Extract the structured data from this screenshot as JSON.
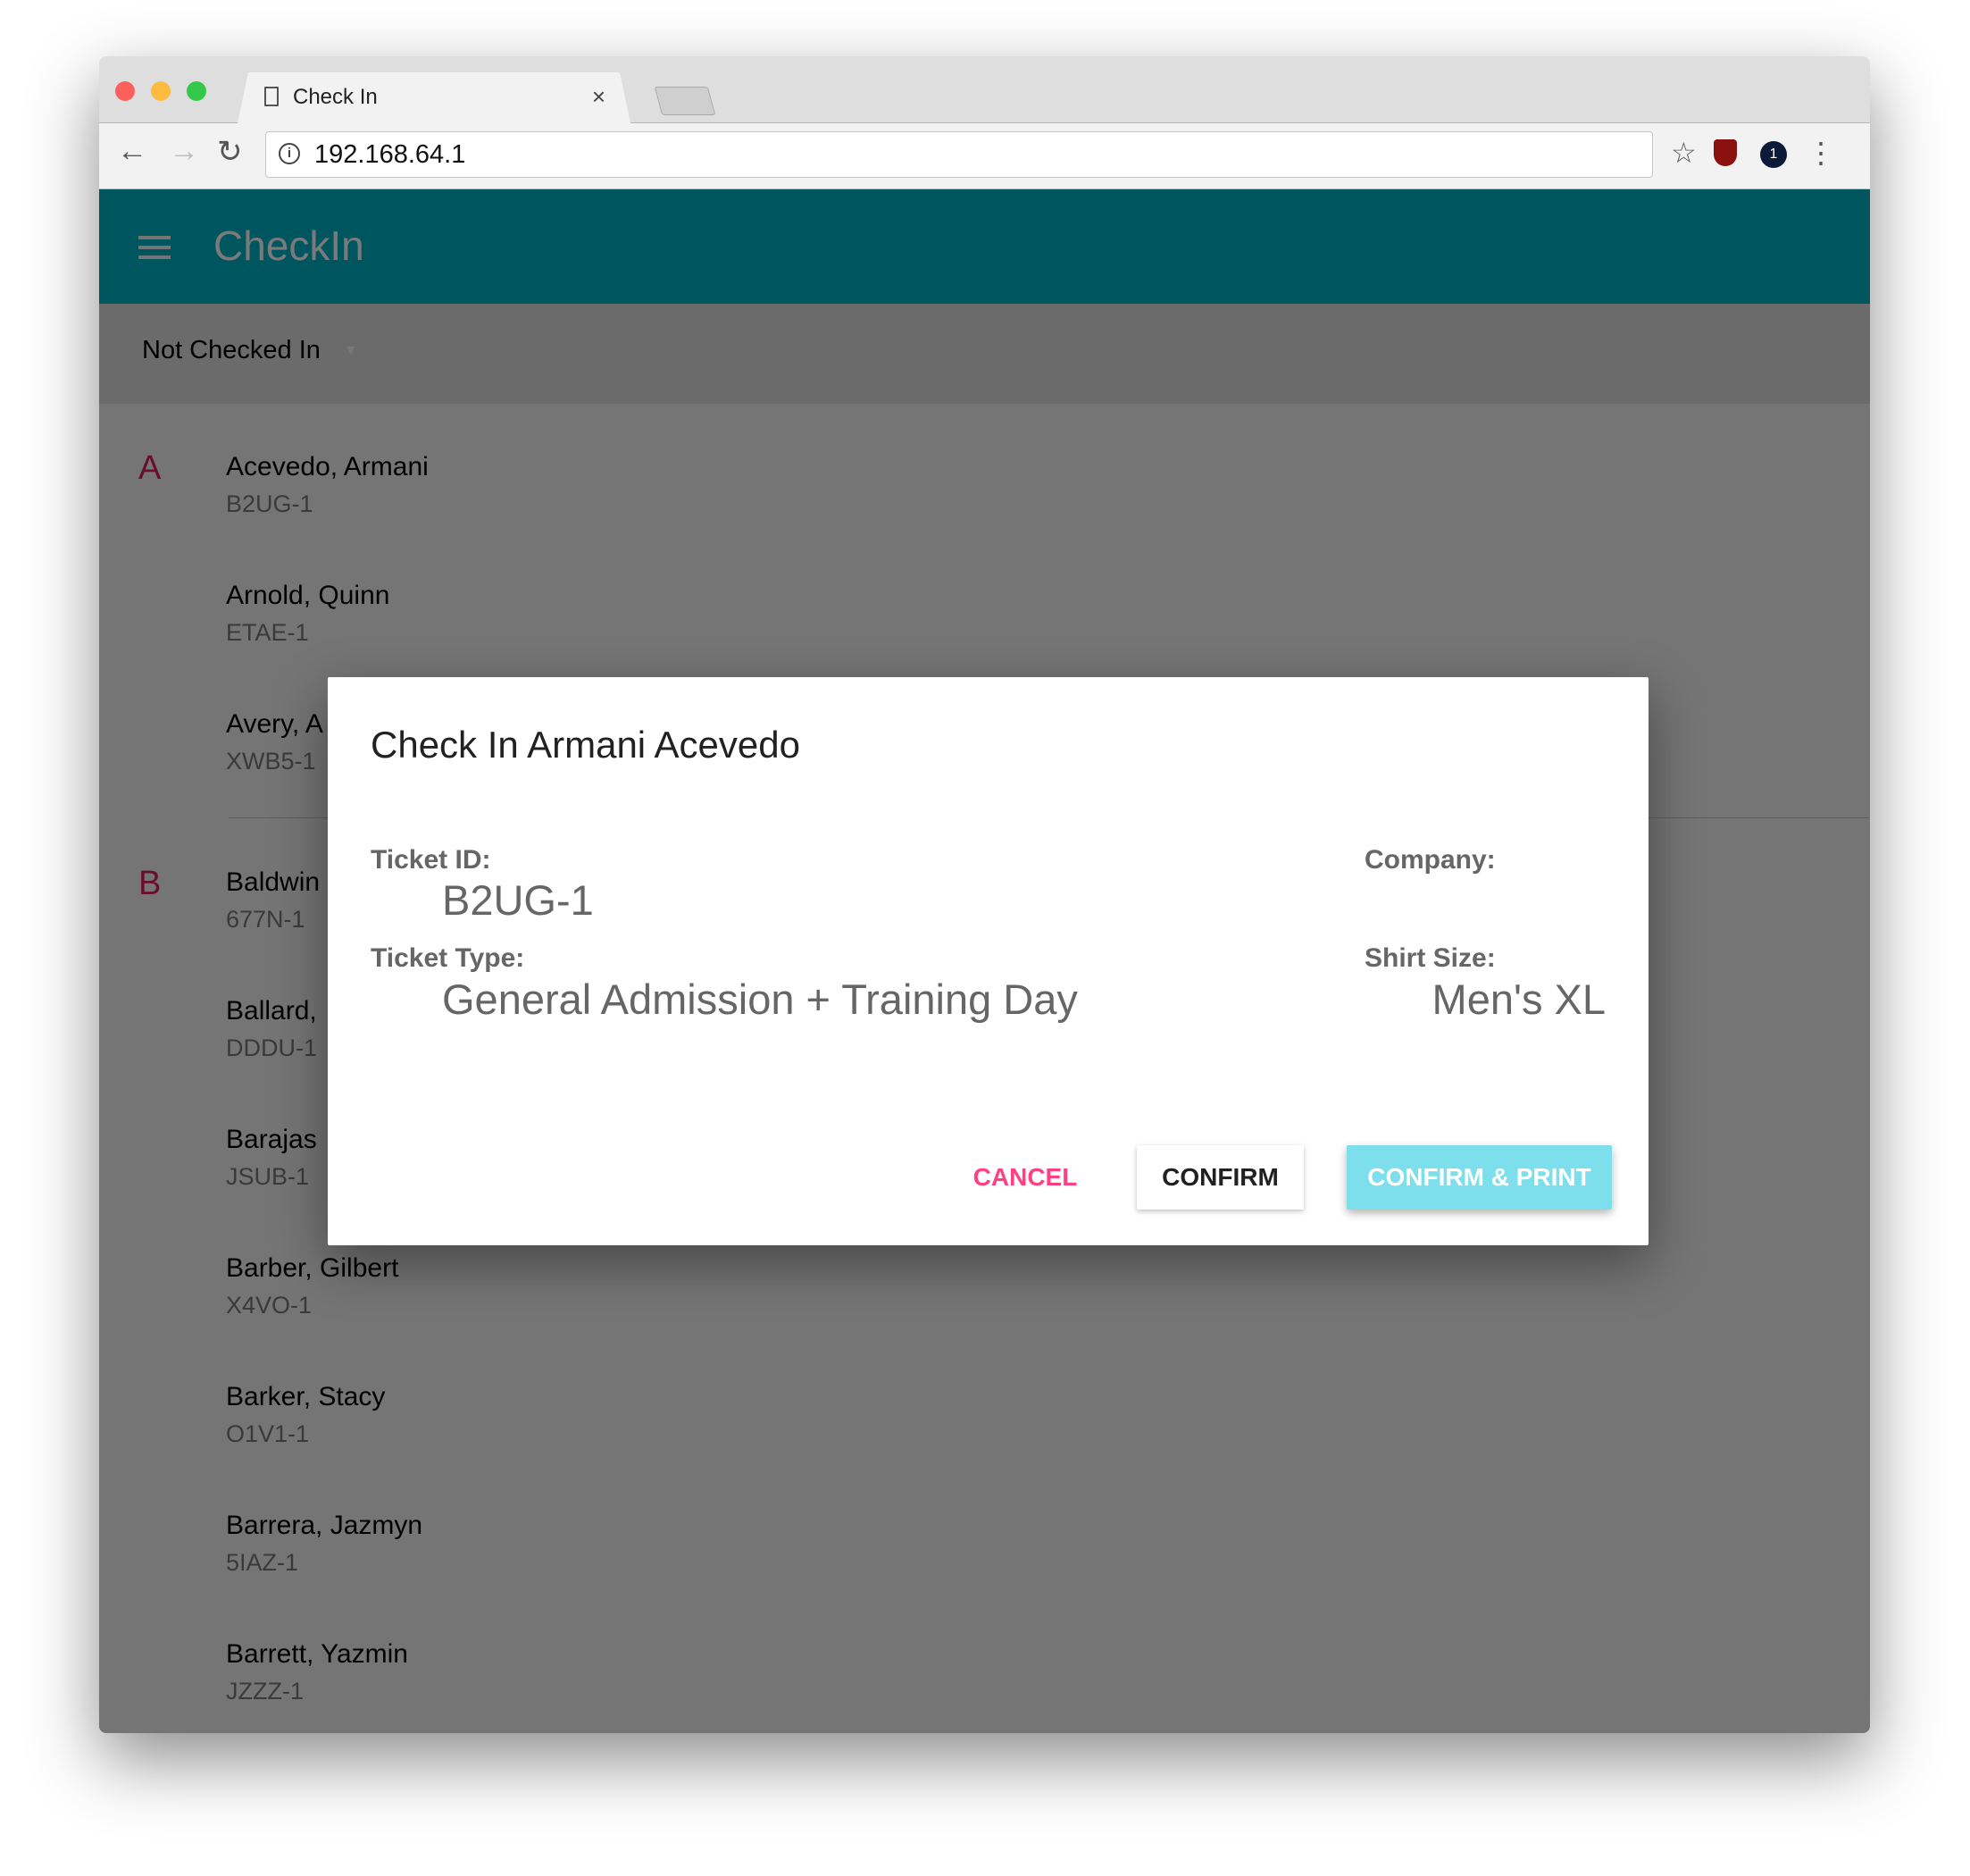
{
  "browser": {
    "tab_title": "Check In",
    "tab_close": "×",
    "url": "192.168.64.1",
    "icons": [
      "back-icon",
      "forward-icon",
      "reload-icon",
      "info-icon",
      "star-icon",
      "ublock-icon",
      "onepassword-icon",
      "more-icon"
    ]
  },
  "app": {
    "title": "CheckIn",
    "filter": "Not Checked In",
    "accent": "#00bcd4",
    "letter_color": "#e91e63"
  },
  "list": {
    "groups": [
      {
        "letter": "A",
        "items": [
          {
            "name": "Acevedo, Armani",
            "id": "B2UG-1"
          },
          {
            "name": "Arnold, Quinn",
            "id": "ETAE-1"
          },
          {
            "name": "Avery, A",
            "id": "XWB5-1"
          }
        ]
      },
      {
        "letter": "B",
        "items": [
          {
            "name": "Baldwin",
            "id": "677N-1"
          },
          {
            "name": "Ballard,",
            "id": "DDDU-1"
          },
          {
            "name": "Barajas",
            "id": "JSUB-1"
          },
          {
            "name": "Barber, Gilbert",
            "id": "X4VO-1"
          },
          {
            "name": "Barker, Stacy",
            "id": "O1V1-1"
          },
          {
            "name": "Barrera, Jazmyn",
            "id": "5IAZ-1"
          },
          {
            "name": "Barrett, Yazmin",
            "id": "JZZZ-1"
          }
        ]
      }
    ]
  },
  "dialog": {
    "title": "Check In Armani Acevedo",
    "ticket_id_label": "Ticket ID:",
    "ticket_id": "B2UG-1",
    "ticket_type_label": "Ticket Type:",
    "ticket_type": "General Admission + Training Day",
    "company_label": "Company:",
    "company": "",
    "shirt_size_label": "Shirt Size:",
    "shirt_size": "Men's XL",
    "cancel": "CANCEL",
    "confirm": "CONFIRM",
    "confirm_print": "CONFIRM & PRINT"
  }
}
